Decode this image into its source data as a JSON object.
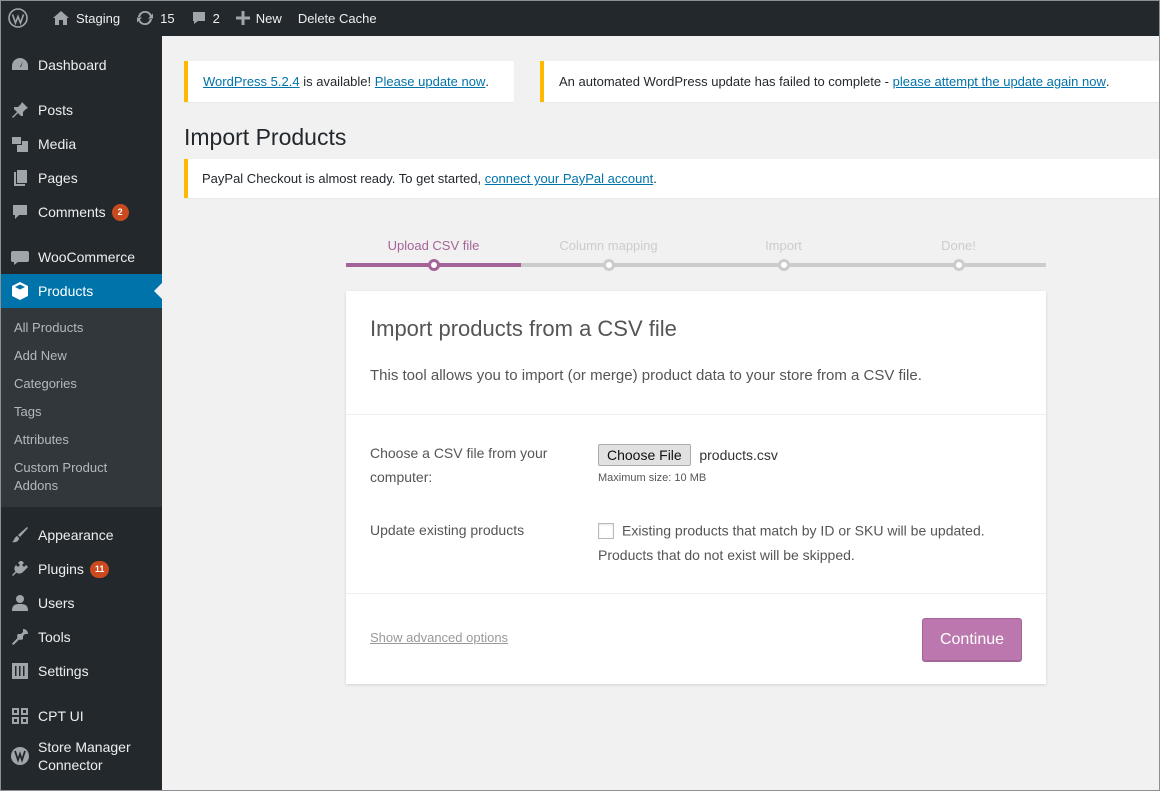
{
  "adminbar": {
    "site_name": "Staging",
    "updates_count": "15",
    "comments_count": "2",
    "new_label": "New",
    "delete_cache_label": "Delete Cache"
  },
  "sidebar": {
    "dashboard": "Dashboard",
    "posts": "Posts",
    "media": "Media",
    "pages": "Pages",
    "comments": "Comments",
    "comments_badge": "2",
    "woocommerce": "WooCommerce",
    "products": "Products",
    "submenu": [
      "All Products",
      "Add New",
      "Categories",
      "Tags",
      "Attributes",
      "Custom Product Addons"
    ],
    "appearance": "Appearance",
    "plugins": "Plugins",
    "plugins_badge": "11",
    "users": "Users",
    "tools": "Tools",
    "settings": "Settings",
    "cpt_ui": "CPT UI",
    "store_manager": "Store Manager Connector"
  },
  "notices": {
    "update_link": "WordPress 5.2.4",
    "update_text": "is available!",
    "update_now_link": "Please update now",
    "failed_text": "An automated WordPress update has failed to complete -",
    "failed_link": "please attempt the update again now",
    "paypal_text": "PayPal Checkout is almost ready. To get started,",
    "paypal_link": "connect your PayPal account"
  },
  "page": {
    "title": "Import Products"
  },
  "steps": [
    "Upload CSV file",
    "Column mapping",
    "Import",
    "Done!"
  ],
  "card": {
    "title": "Import products from a CSV file",
    "description": "This tool allows you to import (or merge) product data to your store from a CSV file.",
    "file_label": "Choose a CSV file from your computer:",
    "choose_file": "Choose File",
    "file_name": "products.csv",
    "max_size": "Maximum size: 10 MB",
    "update_label": "Update existing products",
    "update_check": "Existing products that match by ID or SKU will be updated.",
    "update_note": "Products that do not exist will be skipped.",
    "advanced": "Show advanced options",
    "continue": "Continue"
  },
  "colors": {
    "accent": "#a46497",
    "button": "#bb77ae",
    "adminbar": "#23282d",
    "current_menu": "#0073aa",
    "notice_border": "#ffb900"
  }
}
